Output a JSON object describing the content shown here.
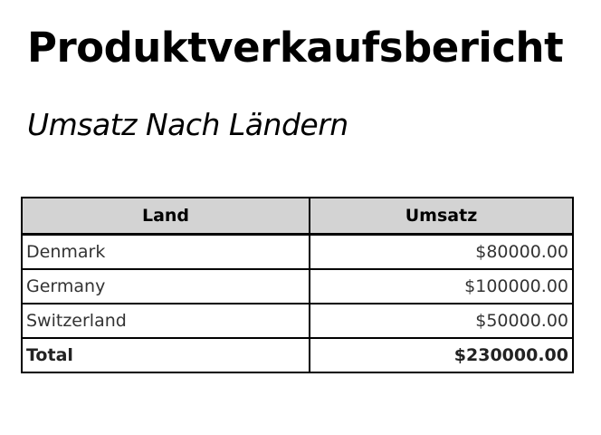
{
  "title": "Produktverkaufsbericht",
  "subtitle": "Umsatz Nach Ländern",
  "table": {
    "headers": [
      "Land",
      "Umsatz"
    ],
    "rows": [
      {
        "land": "Denmark",
        "umsatz": "$80000.00"
      },
      {
        "land": "Germany",
        "umsatz": "$100000.00"
      },
      {
        "land": "Switzerland",
        "umsatz": "$50000.00"
      }
    ],
    "total": {
      "label": "Total",
      "value": "$230000.00"
    }
  }
}
